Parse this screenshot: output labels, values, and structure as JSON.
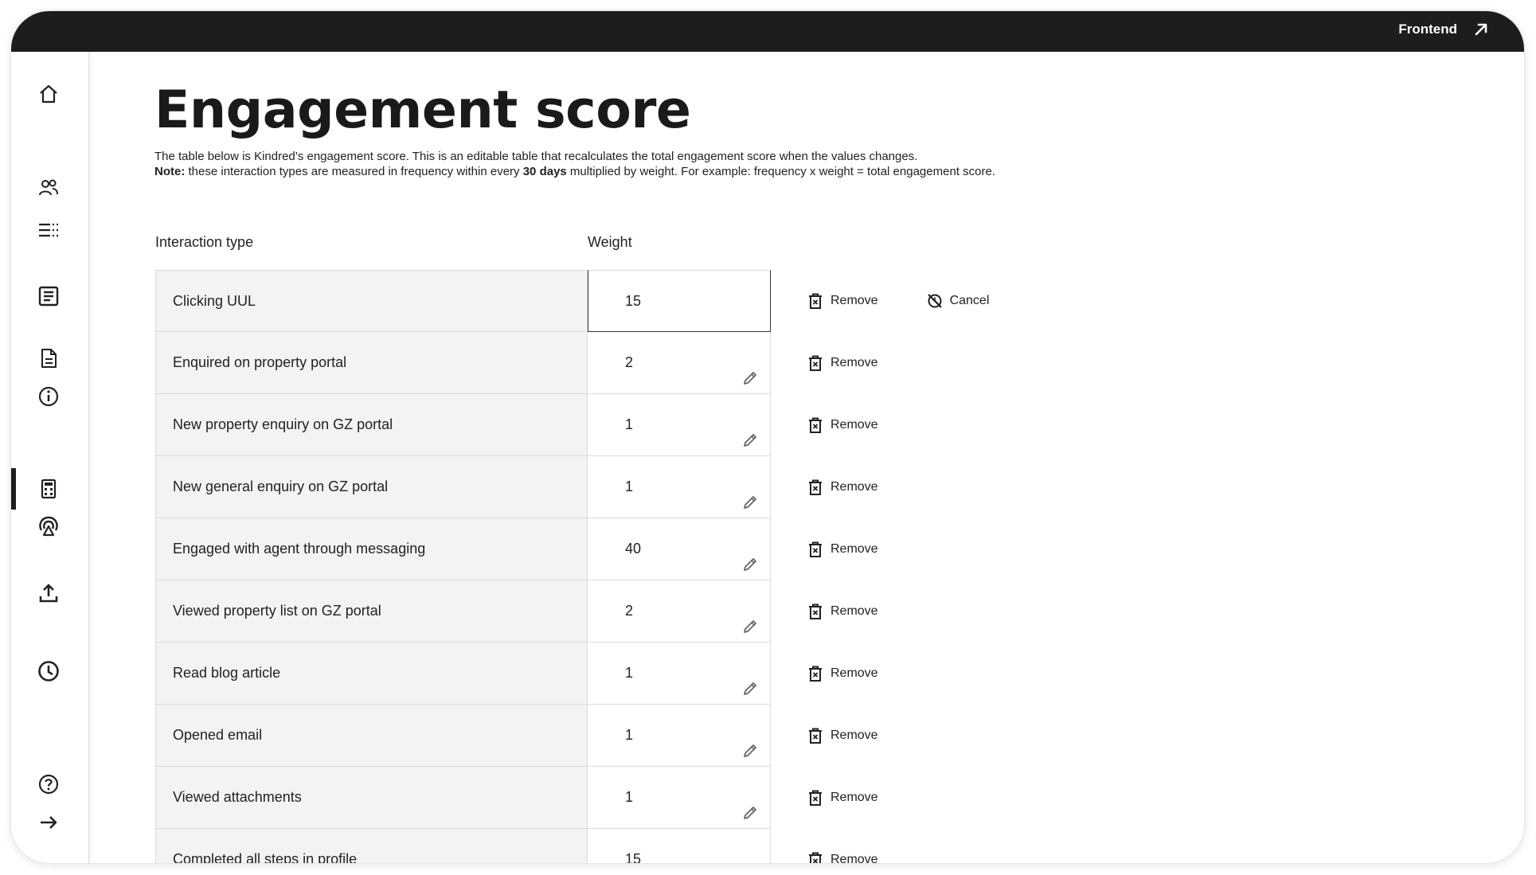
{
  "header": {
    "frontend_label": "Frontend"
  },
  "sidebar": {
    "icons": [
      "home-icon",
      "users-icon",
      "list-icon",
      "article-icon",
      "document-icon",
      "info-icon",
      "calculator-icon",
      "signal-icon",
      "upload-icon",
      "clock-icon",
      "help-icon",
      "arrow-right-icon"
    ],
    "active_item": "calculator-icon"
  },
  "page": {
    "title": "Engagement score",
    "desc_line1": "The table below is Kindred’s engagement score. This is an editable table that recalculates the total engagement score when the values changes.",
    "note_label": "Note:",
    "note_text_a": " these interaction types are measured in frequency within every ",
    "note_days": "30 days",
    "note_text_b": " multiplied by weight. For example: frequency x weight = total engagement score."
  },
  "table": {
    "col_type": "Interaction type",
    "col_weight": "Weight",
    "remove_label": "Remove",
    "cancel_label": "Cancel",
    "rows": [
      {
        "type": "Clicking UUL",
        "weight": "15"
      },
      {
        "type": "Enquired on property portal",
        "weight": "2"
      },
      {
        "type": "New property enquiry on GZ portal",
        "weight": "1"
      },
      {
        "type": "New general enquiry on GZ portal",
        "weight": "1"
      },
      {
        "type": "Engaged with agent through messaging",
        "weight": "40"
      },
      {
        "type": "Viewed property list on GZ portal",
        "weight": "2"
      },
      {
        "type": "Read blog article",
        "weight": "1"
      },
      {
        "type": "Opened email",
        "weight": "1"
      },
      {
        "type": "Viewed attachments",
        "weight": "1"
      },
      {
        "type": "Completed all steps in profile",
        "weight": "15"
      }
    ]
  }
}
